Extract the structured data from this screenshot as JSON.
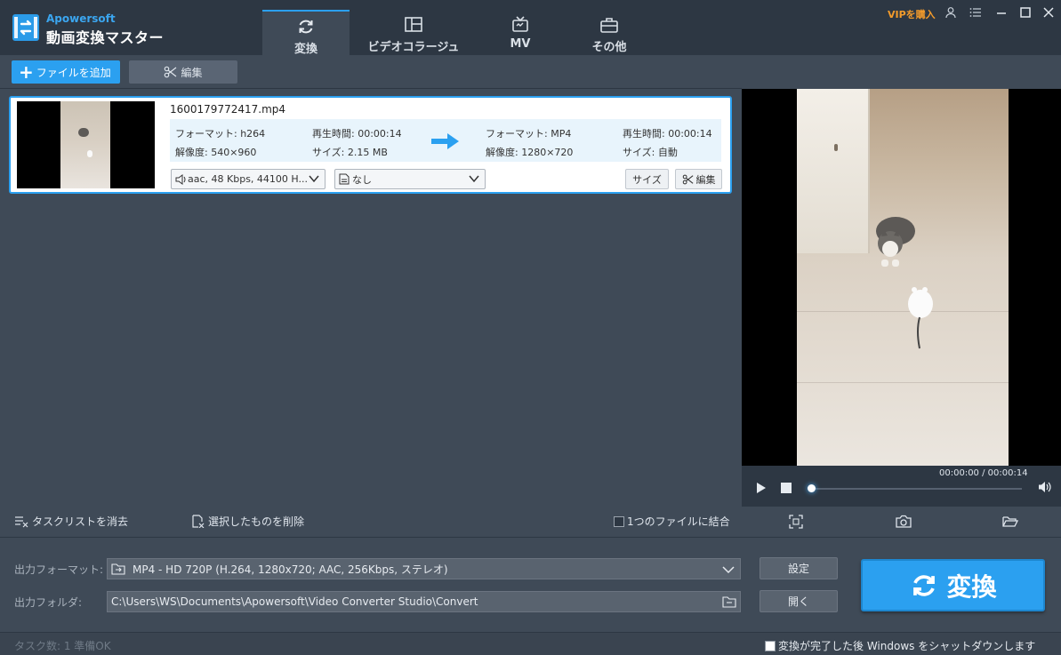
{
  "app": {
    "brand_small": "Apowersoft",
    "brand_name": "動画変換マスター",
    "vip_label": "VIPを購入"
  },
  "tabs": [
    {
      "label": "変換",
      "icon": "refresh-icon",
      "active": true
    },
    {
      "label": "ビデオコラージュ",
      "icon": "collage-icon",
      "active": false
    },
    {
      "label": "MV",
      "icon": "tv-icon",
      "active": false
    },
    {
      "label": "その他",
      "icon": "toolbox-icon",
      "active": false
    }
  ],
  "toolbar": {
    "add_file_label": "ファイルを追加",
    "edit_label": "編集"
  },
  "file": {
    "name": "1600179772417.mp4",
    "source": {
      "format": "フォーマット: h264",
      "duration": "再生時間: 00:00:14",
      "resolution": "解像度: 540×960",
      "size": "サイズ: 2.15 MB"
    },
    "target": {
      "format": "フォーマット: MP4",
      "duration": "再生時間: 00:00:14",
      "resolution": "解像度: 1280×720",
      "size": "サイズ: 自動"
    },
    "audio_track": "aac, 48 Kbps, 44100 H...",
    "subtitle": "なし",
    "size_button": "サイズ",
    "edit_button": "編集"
  },
  "player": {
    "time": "00:00:00 / 00:00:14",
    "progress": 0
  },
  "tasks": {
    "clear_label": "タスクリストを消去",
    "delete_label": "選択したものを削除",
    "merge_label": "1つのファイルに結合"
  },
  "output": {
    "format_label": "出力フォーマット:",
    "format_value": "MP4 - HD 720P (H.264, 1280x720; AAC, 256Kbps, ステレオ)",
    "folder_label": "出力フォルダ:",
    "folder_value": "C:\\Users\\WS\\Documents\\Apowersoft\\Video Converter Studio\\Convert",
    "settings_button": "設定",
    "open_button": "開く",
    "convert_button": "変換"
  },
  "status": {
    "text": "タスク数: 1   準備OK",
    "shutdown_label": "変換が完了した後 Windows をシャットダウンします"
  },
  "colors": {
    "accent": "#2ba0f0",
    "background": "#3f4a57",
    "header": "#2d3743",
    "vip": "#f39b2b"
  }
}
